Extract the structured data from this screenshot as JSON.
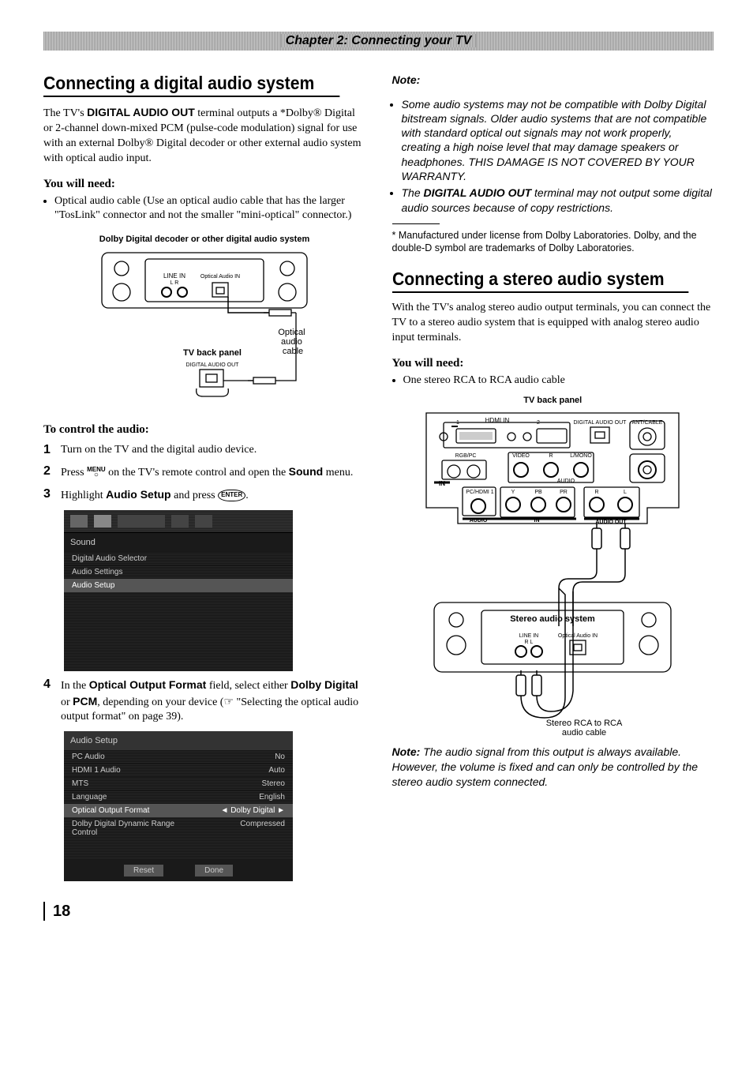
{
  "chapter": "Chapter 2: Connecting your TV",
  "left": {
    "h2": "Connecting a digital audio system",
    "intro_1": "The TV's ",
    "intro_bold": "DIGITAL AUDIO OUT",
    "intro_2": " terminal outputs a *Dolby® Digital or 2-channel down-mixed PCM (pulse-code modulation) signal for use with an external Dolby® Digital decoder or other external audio system with optical audio input.",
    "need_h": "You will need:",
    "need_item": "Optical audio cable (Use an optical audio cable that has the larger \"TosLink\" connector and not the smaller \"mini-optical\" connector.)",
    "fig1": {
      "decoder": "Dolby Digital decoder or other digital audio system",
      "linein": "LINE IN",
      "lr": "L    R",
      "optin": "Optical Audio IN",
      "cable": "Optical audio cable",
      "tvback": "TV back panel",
      "digout": "DIGITAL AUDIO OUT"
    },
    "control_h": "To control the audio:",
    "steps": [
      {
        "n": "1",
        "t1": "Turn on the TV and the digital audio device."
      },
      {
        "n": "2",
        "t1": "Press ",
        "menu": "MENU",
        "t2": " on the TV's remote control and open the ",
        "b": "Sound",
        "t3": " menu."
      },
      {
        "n": "3",
        "t1": "Highlight ",
        "b": "Audio Setup",
        "t2": " and press ",
        "enter": "ENTER",
        "t3": "."
      },
      {
        "n": "4",
        "t1": "In the ",
        "b": "Optical Output Format",
        "t2": " field, select either ",
        "b2": "Dolby Digital",
        "t3": " or ",
        "b3": "PCM",
        "t4": ", depending on your device (☞ \"Selecting the optical audio output format\" on page 39)."
      }
    ],
    "screen1": {
      "title": "Sound",
      "rows": [
        "Digital Audio Selector",
        "Audio Settings",
        "Audio Setup"
      ]
    },
    "screen2": {
      "title": "Audio Setup",
      "rows": [
        [
          "PC Audio",
          "No"
        ],
        [
          "HDMI 1 Audio",
          "Auto"
        ],
        [
          "MTS",
          "Stereo"
        ],
        [
          "Language",
          "English"
        ],
        [
          "Optical Output Format",
          "◄   Dolby Digital   ►"
        ],
        [
          "Dolby Digital Dynamic Range Control",
          "Compressed"
        ]
      ],
      "btns": [
        "Reset",
        "Done"
      ]
    }
  },
  "right": {
    "note_label": "Note:",
    "note_items": [
      "Some audio systems may not be compatible with Dolby Digital bitstream signals. Older audio systems that are not compatible with standard optical out signals may not work properly, creating a high noise level that may damage speakers or headphones. THIS DAMAGE IS NOT COVERED BY YOUR WARRANTY.",
      "The DIGITAL AUDIO OUT terminal may not output some digital audio sources because of copy restrictions."
    ],
    "note_bold_in_2": "DIGITAL AUDIO OUT",
    "footnote": "* Manufactured under license from Dolby Laboratories. Dolby, and the double-D symbol are trademarks of Dolby Laboratories.",
    "h2": "Connecting a stereo audio system",
    "intro": "With the TV's analog stereo audio output terminals, you can connect the TV to a stereo audio system that is equipped with analog stereo audio input terminals.",
    "need_h": "You will need:",
    "need_item": "One stereo RCA to RCA audio cable",
    "fig2": {
      "tvback": "TV back panel",
      "hdmi": "HDMI IN",
      "digout": "DIGITAL AUDIO OUT",
      "ant": "ANT/CABLE",
      "rgb": "RGB/PC",
      "video": "VIDEO",
      "r": "R",
      "lmono": "L/MONO",
      "in": "IN",
      "pchdmi": "PC/HDMI 1",
      "y": "Y",
      "pb": "PB",
      "pr": "PR",
      "audio": "AUDIO",
      "audioout": "AUDIO OUT",
      "stereo": "Stereo audio system",
      "linein": "LINE IN",
      "lr": "R    L",
      "optin": "Optical Audio IN",
      "cable": "Stereo RCA to RCA audio cable"
    },
    "note2_label": "Note:",
    "note2": " The audio signal from this output is always available. However, the volume is fixed and can only be controlled by the stereo audio system connected."
  },
  "page_number": "18"
}
